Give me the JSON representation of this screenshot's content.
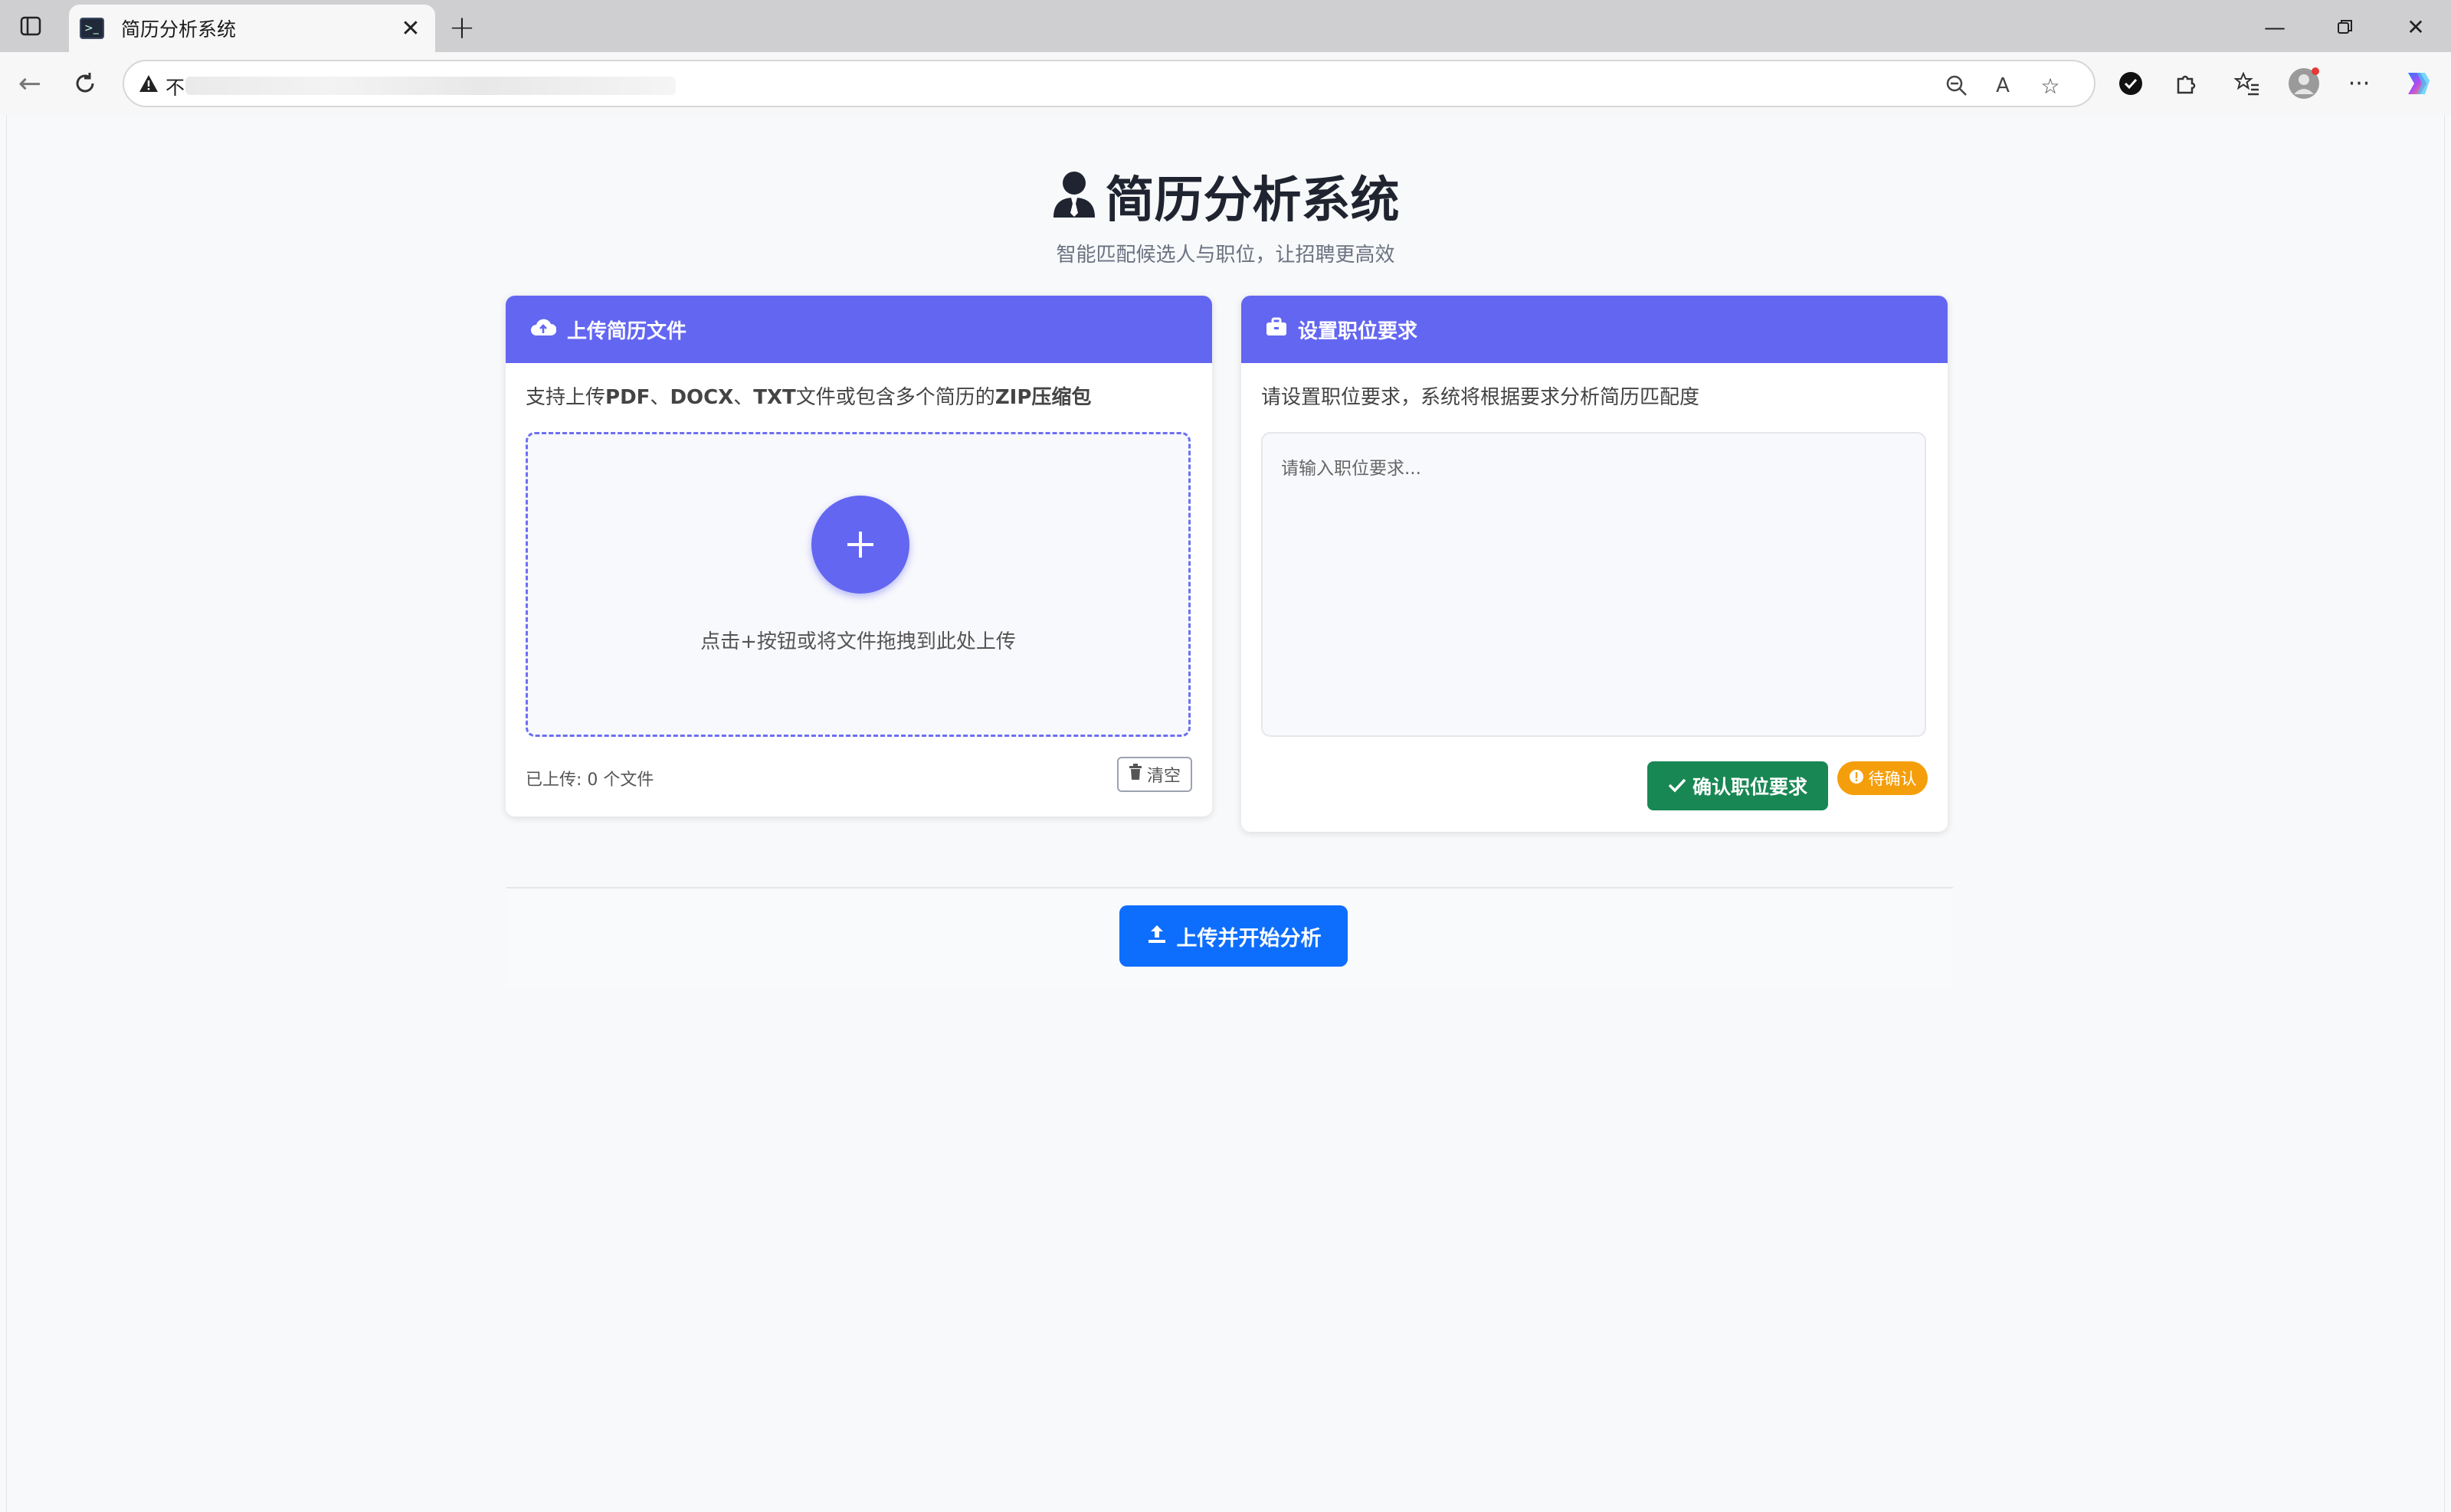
{
  "browser": {
    "tab_title": "简历分析系统",
    "address_prefix": "不"
  },
  "hero": {
    "title": "简历分析系统",
    "subtitle": "智能匹配候选人与职位，让招聘更高效"
  },
  "upload_card": {
    "header": "上传简历文件",
    "desc_parts": [
      "支持上传",
      "PDF",
      "、",
      "DOCX",
      "、",
      "TXT",
      "文件或包含多个简历的",
      "ZIP压缩包"
    ],
    "drop_hint": "点击+按钮或将文件拖拽到此处上传",
    "upload_count": "已上传: 0 个文件",
    "clear_label": "清空"
  },
  "req_card": {
    "header": "设置职位要求",
    "desc": "请设置职位要求，系统将根据要求分析简历匹配度",
    "placeholder": "请输入职位要求...",
    "confirm_label": "确认职位要求",
    "status_badge": "待确认"
  },
  "actions": {
    "start_label": "上传并开始分析"
  },
  "colors": {
    "accent": "#6366f1",
    "success": "#198754",
    "warning": "#f59e0b",
    "primary": "#0d6efd"
  }
}
